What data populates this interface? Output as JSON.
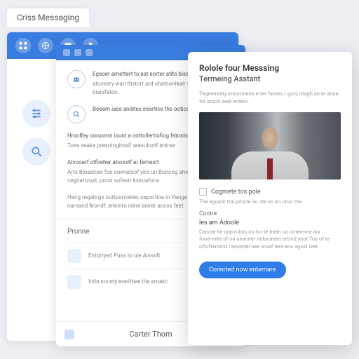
{
  "tab": {
    "label": "Criss Messaging"
  },
  "background": {
    "icons": [
      "grid-icon",
      "globe-icon",
      "chat-icon",
      "person-icon"
    ]
  },
  "side": {
    "icons": [
      "sliders-icon",
      "search-icon"
    ]
  },
  "mid": {
    "rows": [
      {
        "icon": "robot-icon",
        "t1": "Egsoer arnettert to ast eorter atits bissrse",
        "t2": "atovnery wan tfistort ard ohatconikalr sotwenr bialsfaton."
      },
      {
        "icon": "search-icon",
        "t1": "Boeam iass andites iresrtice ths ooticst.",
        "t2": ""
      },
      {
        "icon": "",
        "t1": "Hroolfey ooroonrn iount a oottollertiufiog fstosts.",
        "t2": "Toes seake presntngitoslf aresulostf entrse"
      },
      {
        "icon": "",
        "t1": "Atvooerf otfireher atrosstf er femestt",
        "t2": "Arts Bloealoor foe onwratsof yiro un Biarong ahoerinorn itoaip our cegitattzost, proot sofestr kslorafons."
      },
      {
        "icon": "",
        "t1": "Hang regaltrgs outtpomalres oeportina in Pange tos beosor narnand firondf, erleinro ialrol anirer acoss feet."
      }
    ],
    "section_label": "Prunne",
    "items": [
      "Entortyed Puss to ole Aisssft",
      "Intin socety ererithee the ernakc"
    ],
    "footer": "Carter Thom"
  },
  "modal": {
    "title": "Rolole four Messsing",
    "subtitle": "Termeing Asstant",
    "sub": "Tegerentety smuotnene erter fantes / gurs ittagh an te atine fot arsolt seet erders.",
    "check_label": "Cogmete tos pole",
    "check_desc": "The egoatir the prbote ac ote sn an rmor the",
    "field_label": "Contre",
    "role_label": "les am Adoole",
    "role_desc": "Cancre he uop mlsts on for te tneln uo ontermne aur fouerrnite of on anaister netscatien ertmd yout Tos of te oftofterstrst clesatdel oee arsef tere enu agsst iiret.",
    "button": "Corected now entemare"
  }
}
